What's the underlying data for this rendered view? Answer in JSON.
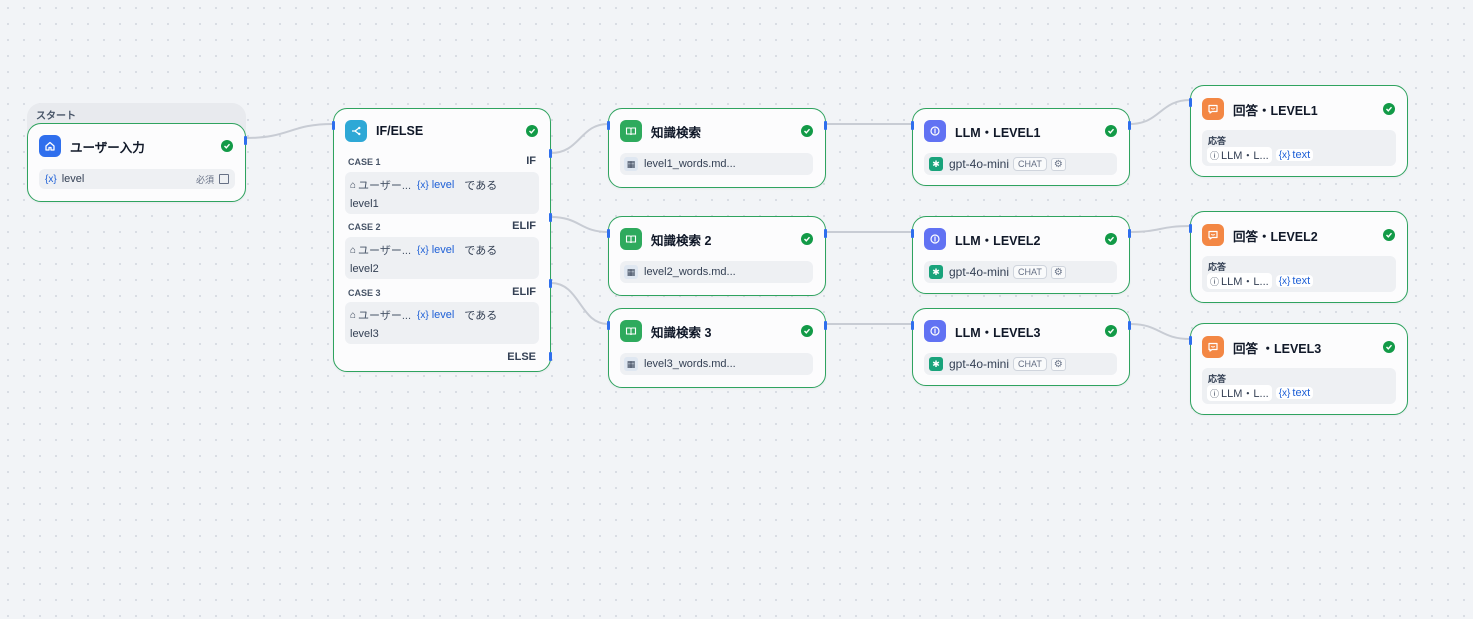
{
  "colors": {
    "accent": "#2f6fed",
    "success": "#129a47",
    "node_border": "#2fa35f",
    "knowledge": "#2eaa5d",
    "llm": "#6172f3",
    "answer": "#f38744",
    "ifelse": "#2ea8d6",
    "start": "#2f6fed"
  },
  "start": {
    "tag": "スタート",
    "title": "ユーザー入力",
    "icon": "home-icon",
    "var_prefix": "{x}",
    "var_name": "level",
    "required": "必須"
  },
  "ifelse": {
    "title": "IF/ELSE",
    "icon": "branch-icon",
    "cases": [
      {
        "label": "CASE 1",
        "kind": "IF",
        "source": "ユーザー...",
        "var_prefix": "{x}",
        "var": "level",
        "op": "である",
        "value": "level1"
      },
      {
        "label": "CASE 2",
        "kind": "ELIF",
        "source": "ユーザー...",
        "var_prefix": "{x}",
        "var": "level",
        "op": "である",
        "value": "level2"
      },
      {
        "label": "CASE 3",
        "kind": "ELIF",
        "source": "ユーザー...",
        "var_prefix": "{x}",
        "var": "level",
        "op": "である",
        "value": "level3"
      }
    ],
    "else_label": "ELSE"
  },
  "knowledge": [
    {
      "title": "知識検索",
      "file": "level1_words.md..."
    },
    {
      "title": "知識検索 2",
      "file": "level2_words.md..."
    },
    {
      "title": "知識検索 3",
      "file": "level3_words.md..."
    }
  ],
  "llm": [
    {
      "title": "LLM・LEVEL1",
      "model": "gpt-4o-mini",
      "badge": "CHAT"
    },
    {
      "title": "LLM・LEVEL2",
      "model": "gpt-4o-mini",
      "badge": "CHAT"
    },
    {
      "title": "LLM・LEVEL3",
      "model": "gpt-4o-mini",
      "badge": "CHAT"
    }
  ],
  "answer": [
    {
      "title": "回答・LEVEL1",
      "label": "応答",
      "source": "LLM・L...",
      "var_prefix": "{x}",
      "var": "text"
    },
    {
      "title": "回答・LEVEL2",
      "label": "応答",
      "source": "LLM・L...",
      "var_prefix": "{x}",
      "var": "text"
    },
    {
      "title": "回答 ・LEVEL3",
      "label": "応答",
      "source": "LLM・L...",
      "var_prefix": "{x}",
      "var": "text"
    }
  ]
}
